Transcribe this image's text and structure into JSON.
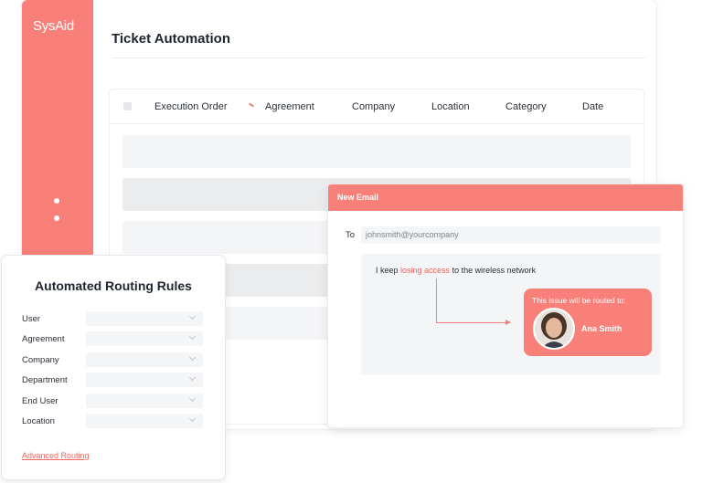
{
  "brand": {
    "logo_text": "SysAid",
    "logo_mark": ".",
    "accent_color": "#f88079"
  },
  "page": {
    "title": "Ticket Automation"
  },
  "table": {
    "columns": [
      "Execution Order",
      "Agreement",
      "Company",
      "Location",
      "Category",
      "Date"
    ],
    "row_count": 6
  },
  "rules": {
    "title": "Automated Routing Rules",
    "fields": [
      "User",
      "Agreement",
      "Company",
      "Department",
      "End User",
      "Location"
    ],
    "advanced_link": "Advanced Routing"
  },
  "email": {
    "title": "New Email",
    "to_label": "To",
    "to_value": "johnsmith@yourcompany",
    "body_prefix": "I keep ",
    "body_highlight": "losing access",
    "body_suffix": " to the wireless network",
    "route_text": "This issue will be routed to:",
    "route_name": "Ana Smith"
  },
  "icons": {
    "checkbox": "checkbox-icon",
    "dropdown": "chevron-down-icon",
    "avatar": "user-avatar"
  }
}
